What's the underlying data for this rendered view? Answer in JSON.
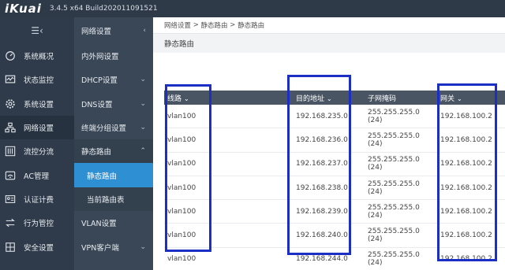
{
  "app": {
    "logo": "iKuai",
    "version": "3.4.5 x64 Build202011091521"
  },
  "sidebar": {
    "collapse_glyph": "☰‹",
    "items": [
      {
        "label": "系统概况",
        "icon": "gauge-icon"
      },
      {
        "label": "状态监控",
        "icon": "monitor-icon"
      },
      {
        "label": "系统设置",
        "icon": "gear-icon"
      },
      {
        "label": "网络设置",
        "icon": "network-icon",
        "active": true
      },
      {
        "label": "流控分流",
        "icon": "sliders-icon"
      },
      {
        "label": "AC管理",
        "icon": "wifi-icon"
      },
      {
        "label": "认证计费",
        "icon": "idcard-icon"
      },
      {
        "label": "行为管控",
        "icon": "arrows-icon"
      },
      {
        "label": "安全设置",
        "icon": "shield-icon"
      }
    ]
  },
  "submenu": {
    "title": "网络设置",
    "items": [
      {
        "label": "内外网设置"
      },
      {
        "label": "DHCP设置"
      },
      {
        "label": "DNS设置"
      },
      {
        "label": "终端分组设置"
      },
      {
        "label": "静态路由"
      },
      {
        "label": "静态路由"
      },
      {
        "label": "当前路由表"
      },
      {
        "label": "VLAN设置"
      },
      {
        "label": "VPN客户端"
      }
    ]
  },
  "breadcrumb": {
    "items": [
      "网络设置",
      "静态路由",
      "静态路由"
    ],
    "sep": " > "
  },
  "page": {
    "title": "静态路由"
  },
  "table": {
    "headers": [
      "线路",
      "目的地址",
      "子网掩码",
      "网关"
    ],
    "rows": [
      [
        "vlan100",
        "192.168.235.0",
        "255.255.255.0 (24)",
        "192.168.100.2"
      ],
      [
        "vlan100",
        "192.168.236.0",
        "255.255.255.0 (24)",
        "192.168.100.2"
      ],
      [
        "vlan100",
        "192.168.237.0",
        "255.255.255.0 (24)",
        "192.168.100.2"
      ],
      [
        "vlan100",
        "192.168.238.0",
        "255.255.255.0 (24)",
        "192.168.100.2"
      ],
      [
        "vlan100",
        "192.168.239.0",
        "255.255.255.0 (24)",
        "192.168.100.2"
      ],
      [
        "vlan100",
        "192.168.240.0",
        "255.255.255.0 (24)",
        "192.168.100.2"
      ],
      [
        "vlan100",
        "192.168.244.0",
        "255.255.255.0 (24)",
        "192.168.100.2"
      ]
    ]
  },
  "colors": {
    "topbar": "#2e3a48",
    "sidebar": "#2f3b4a",
    "submenu": "#3a4756",
    "selected": "#2f8fd3",
    "table_header": "#4a5563",
    "annotation": "#1b2fc4"
  }
}
